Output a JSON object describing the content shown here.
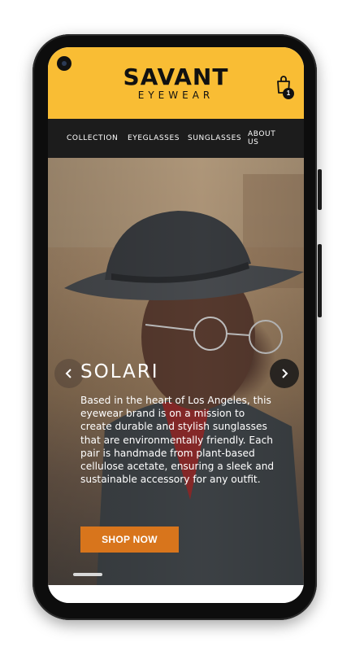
{
  "header": {
    "brand_main": "SAVANT",
    "brand_sub": "EYEWEAR",
    "cart_icon": "shopping-bag-icon",
    "cart_count": "1",
    "accent_color": "#f9bd34"
  },
  "nav": {
    "items": [
      {
        "label": "COLLECTION"
      },
      {
        "label": "EYEGLASSES"
      },
      {
        "label": "SUNGLASSES"
      },
      {
        "label": "ABOUT US"
      }
    ]
  },
  "hero": {
    "title": "SOLARI",
    "description": "Based in the heart of Los Angeles, this eyewear brand is on a mission to create durable and stylish sunglasses that are environmentally friendly. Each pair is handmade from plant-based cellulose acetate, ensuring a sleek and sustainable accessory for any outfit.",
    "cta_label": "SHOP NOW",
    "cta_color": "#d8751c",
    "prev_icon": "chevron-left-icon",
    "next_icon": "chevron-right-icon"
  }
}
